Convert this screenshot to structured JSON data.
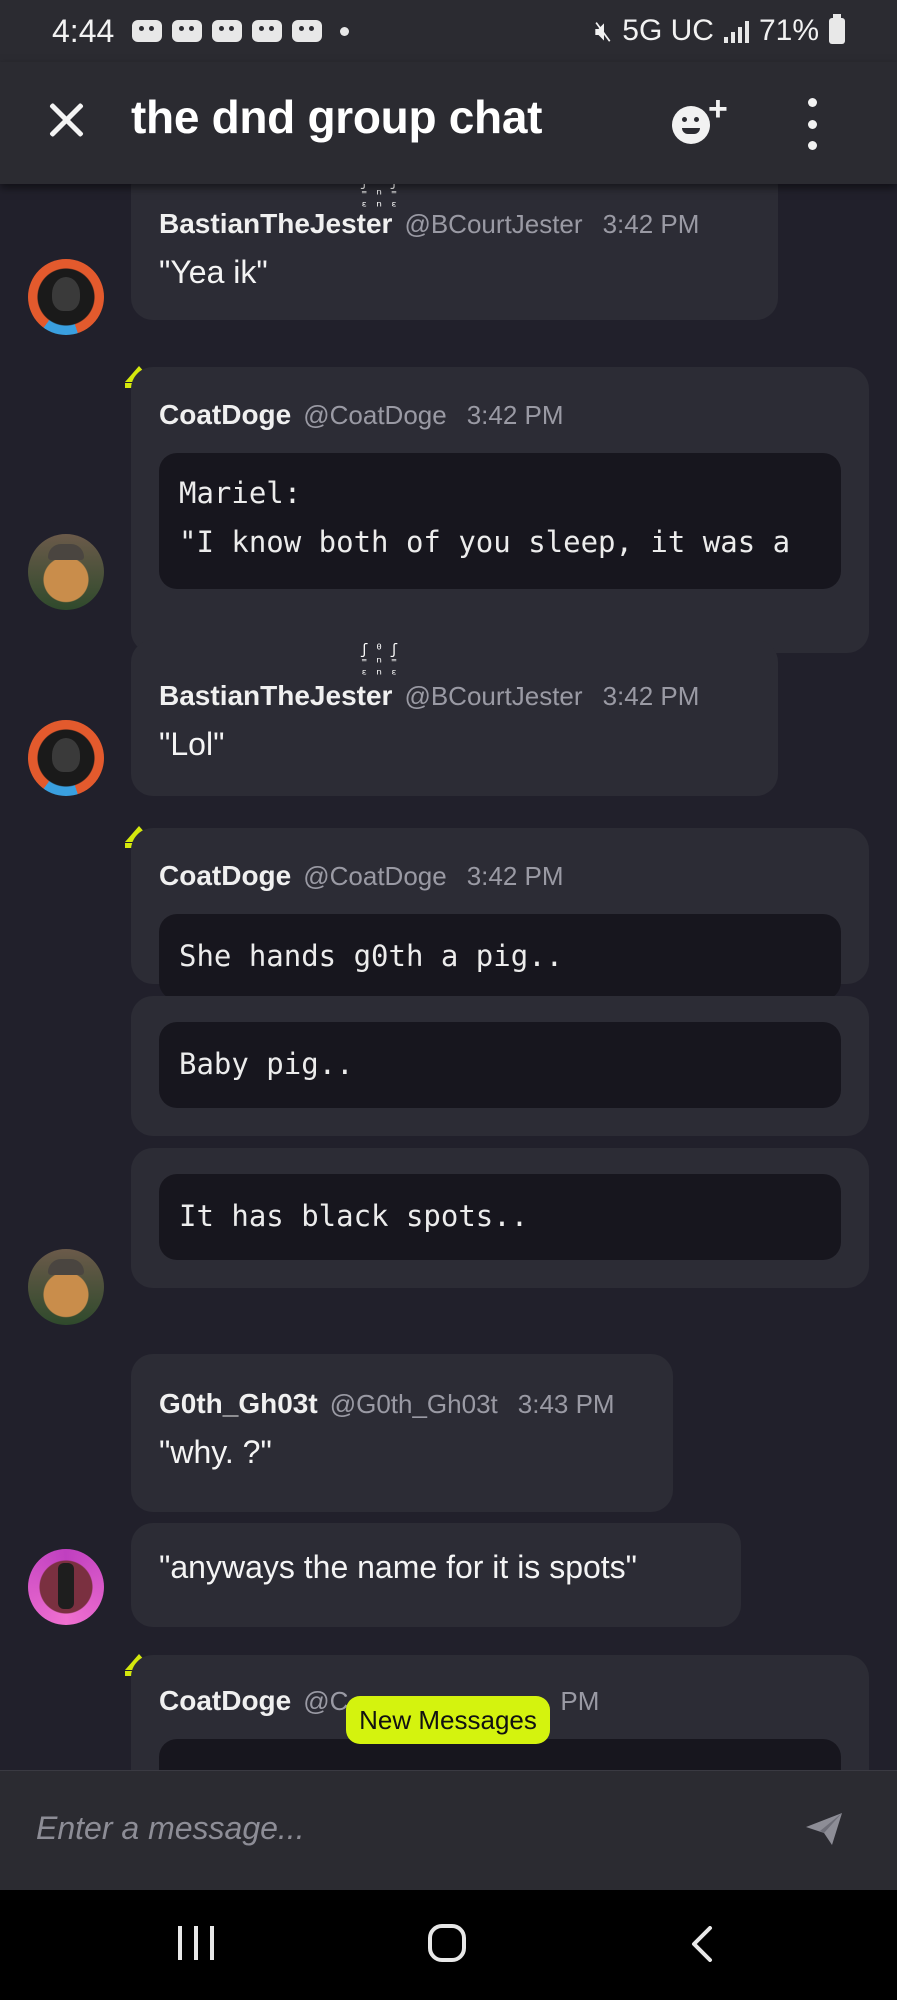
{
  "status_bar": {
    "time": "4:44",
    "network": "5G UC",
    "battery": "71%"
  },
  "header": {
    "title": "the dnd group chat"
  },
  "messages": [
    {
      "name": "BastianTheJester",
      "handle": "@BCourtJester",
      "time": "3:42 PM",
      "text": "\"Yea ik\""
    },
    {
      "name": "CoatDoge",
      "handle": "@CoatDoge",
      "time": "3:42 PM",
      "code": "Mariel:\n\"I know both of you sleep, it was a"
    },
    {
      "name": "BastianTheJester",
      "handle": "@BCourtJester",
      "time": "3:42 PM",
      "text": "\"Lol\""
    },
    {
      "name": "CoatDoge",
      "handle": "@CoatDoge",
      "time": "3:42 PM",
      "code": "She hands g0th a pig.."
    },
    {
      "code": "Baby pig.."
    },
    {
      "code": "It has black spots.."
    },
    {
      "name": "G0th_Gh03t",
      "handle": "@G0th_Gh03t",
      "time": "3:43 PM",
      "text": "\"why. ?\""
    },
    {
      "text": "\"anyways the name for it is spots\""
    },
    {
      "name": "CoatDoge",
      "handle": "@C",
      "time": "PM"
    }
  ],
  "new_messages_label": "New Messages",
  "composer": {
    "placeholder": "Enter a message..."
  }
}
